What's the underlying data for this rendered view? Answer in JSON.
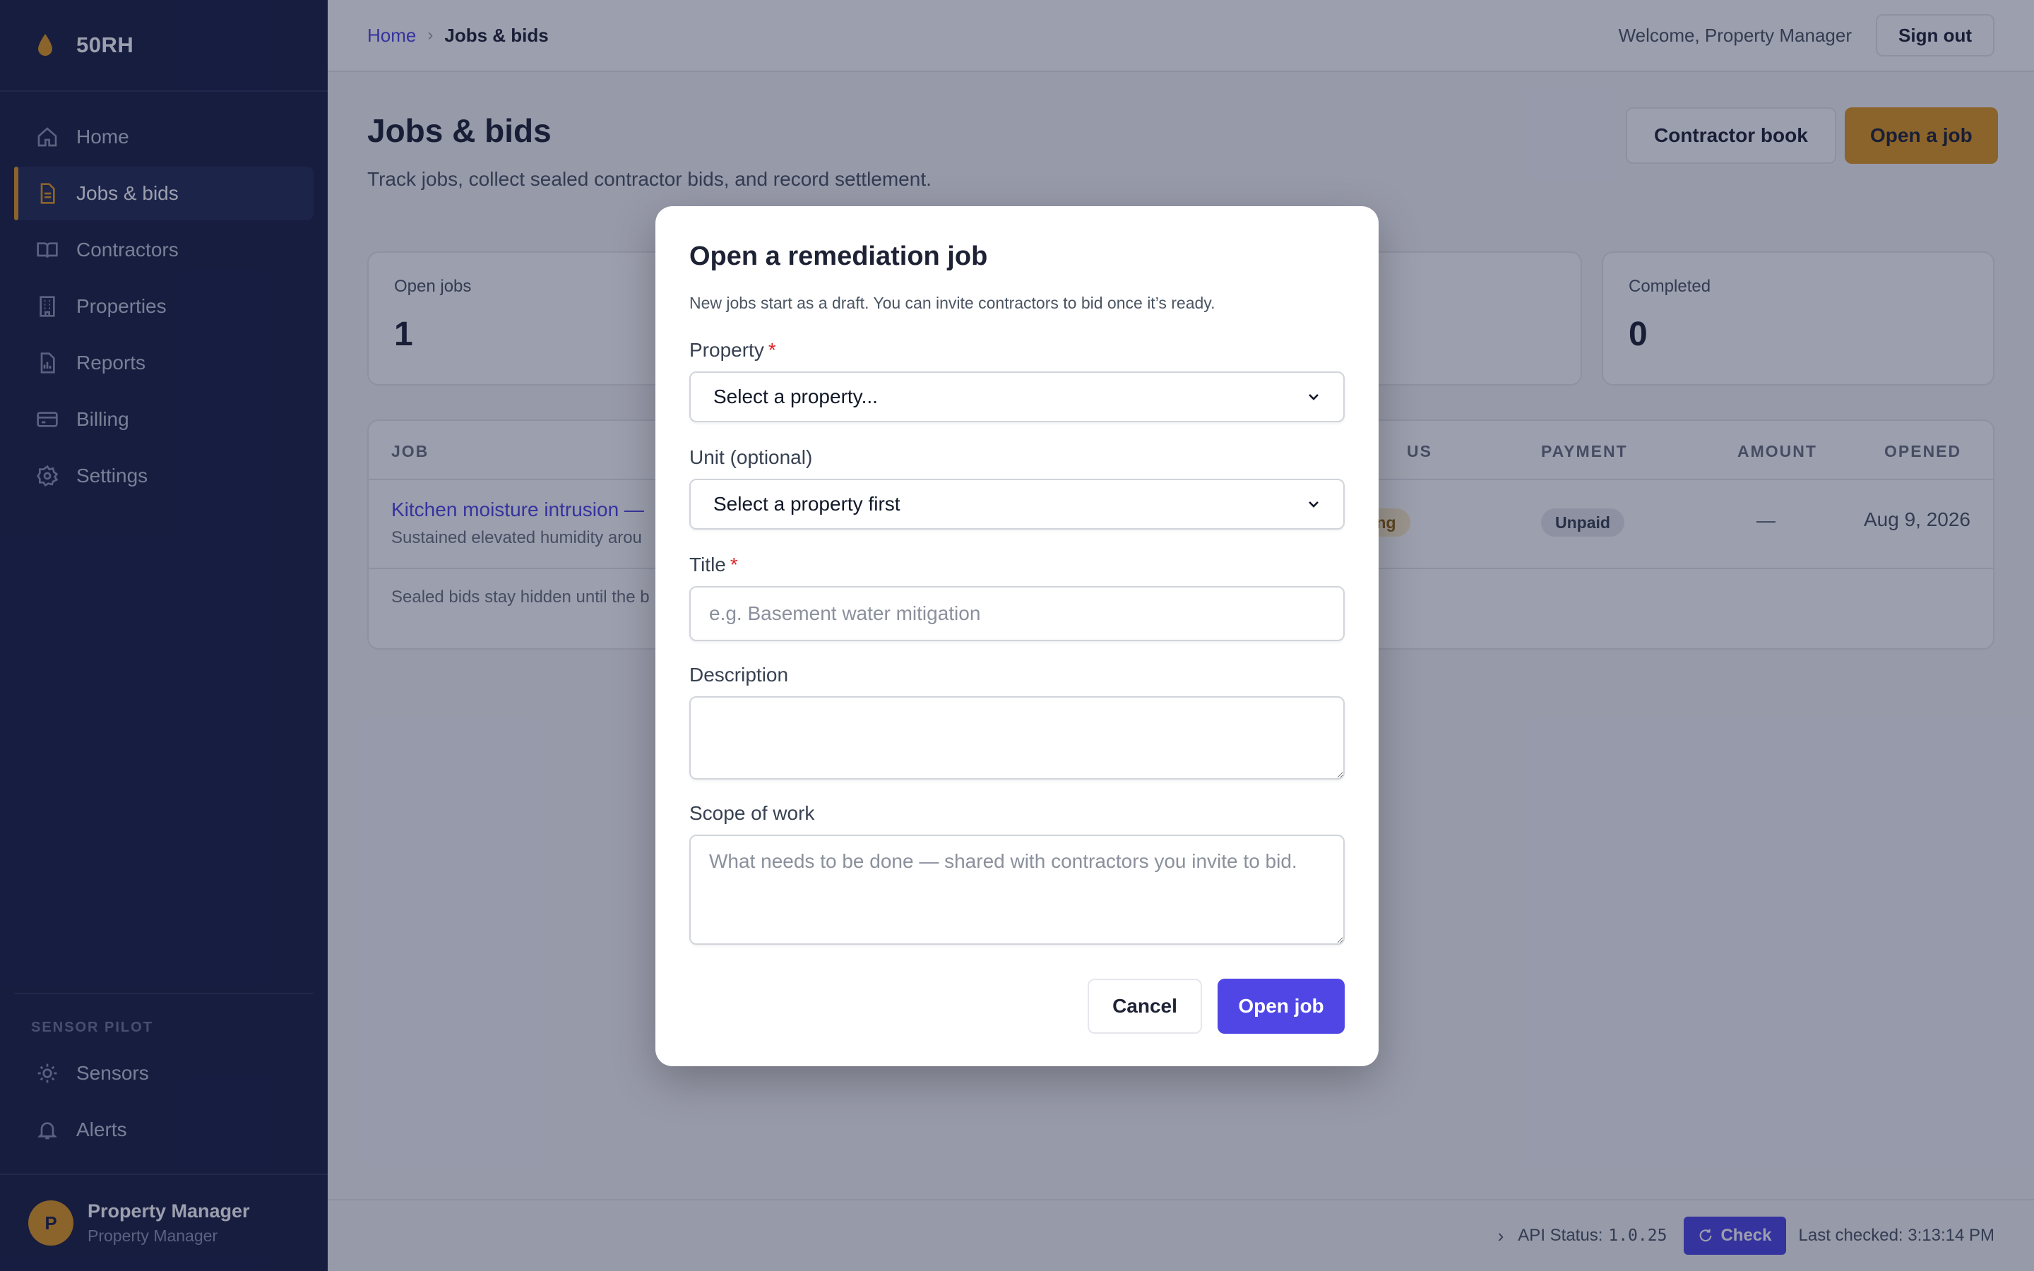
{
  "brand": {
    "name": "50RH",
    "logo_icon": "droplet-icon",
    "accent": "#e29a1f"
  },
  "sidebar": {
    "items": [
      {
        "label": "Home",
        "icon": "home-icon"
      },
      {
        "label": "Jobs & bids",
        "icon": "document-icon",
        "active": true
      },
      {
        "label": "Contractors",
        "icon": "book-icon"
      },
      {
        "label": "Properties",
        "icon": "building-icon"
      },
      {
        "label": "Reports",
        "icon": "report-icon"
      },
      {
        "label": "Billing",
        "icon": "credit-card-icon"
      },
      {
        "label": "Settings",
        "icon": "gear-icon"
      }
    ],
    "section_label": "SENSOR PILOT",
    "section_items": [
      {
        "label": "Sensors",
        "icon": "sun-icon"
      },
      {
        "label": "Alerts",
        "icon": "bell-icon"
      }
    ],
    "profile": {
      "initial": "P",
      "name": "Property Manager",
      "role": "Property Manager"
    }
  },
  "header": {
    "breadcrumb_home": "Home",
    "breadcrumb_separator": "›",
    "breadcrumb_current": "Jobs & bids",
    "welcome": "Welcome, Property Manager",
    "sign_out": "Sign out"
  },
  "page": {
    "title": "Jobs & bids",
    "subtitle": "Track jobs, collect sealed contractor bids, and record settlement.",
    "contractor_book": "Contractor book",
    "open_job": "Open a job"
  },
  "stats": [
    {
      "label": "Open jobs",
      "value": "1"
    },
    {
      "label": "Completed",
      "value": "0"
    }
  ],
  "table": {
    "headers": {
      "job": "JOB",
      "status": "US",
      "payment": "PAYMENT",
      "amount": "AMOUNT",
      "opened": "OPENED"
    },
    "rows": [
      {
        "title": "Kitchen moisture intrusion —",
        "desc": "Sustained elevated humidity arou",
        "status": "ing",
        "payment": "Unpaid",
        "amount": "—",
        "opened": "Aug 9, 2026"
      }
    ],
    "footnote": "Sealed bids stay hidden until the b"
  },
  "statusbar": {
    "chevron": "›",
    "api_label": "API Status:",
    "api_version": "1.0.25",
    "check": "Check",
    "last_checked": "Last checked: 3:13:14 PM"
  },
  "modal": {
    "title": "Open a remediation job",
    "subtitle": "New jobs start as a draft. You can invite contractors to bid once it’s ready.",
    "property_label": "Property",
    "required_mark": "*",
    "property_value": "Select a property...",
    "unit_label": "Unit (optional)",
    "unit_value": "Select a property first",
    "title_label": "Title",
    "title_placeholder": "e.g. Basement water mitigation",
    "description_label": "Description",
    "scope_label": "Scope of work",
    "scope_placeholder": "What needs to be done — shared with contractors you invite to bid.",
    "cancel": "Cancel",
    "submit": "Open job"
  }
}
